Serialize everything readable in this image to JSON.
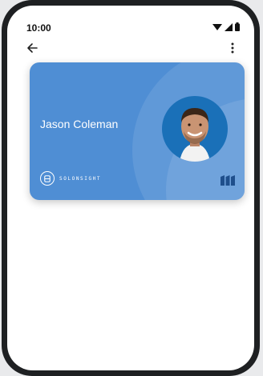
{
  "status_bar": {
    "time": "10:00",
    "icons": [
      "wifi-icon",
      "signal-icon",
      "battery-icon"
    ]
  },
  "app_bar": {
    "back_icon": "arrow-left-icon",
    "menu_icon": "more-vertical-icon"
  },
  "card": {
    "holder_name": "Jason Coleman",
    "company_name": "SOLONSIGHT",
    "background_color": "#4f8ed4",
    "brand_mark_color": "#1f4f8c"
  }
}
